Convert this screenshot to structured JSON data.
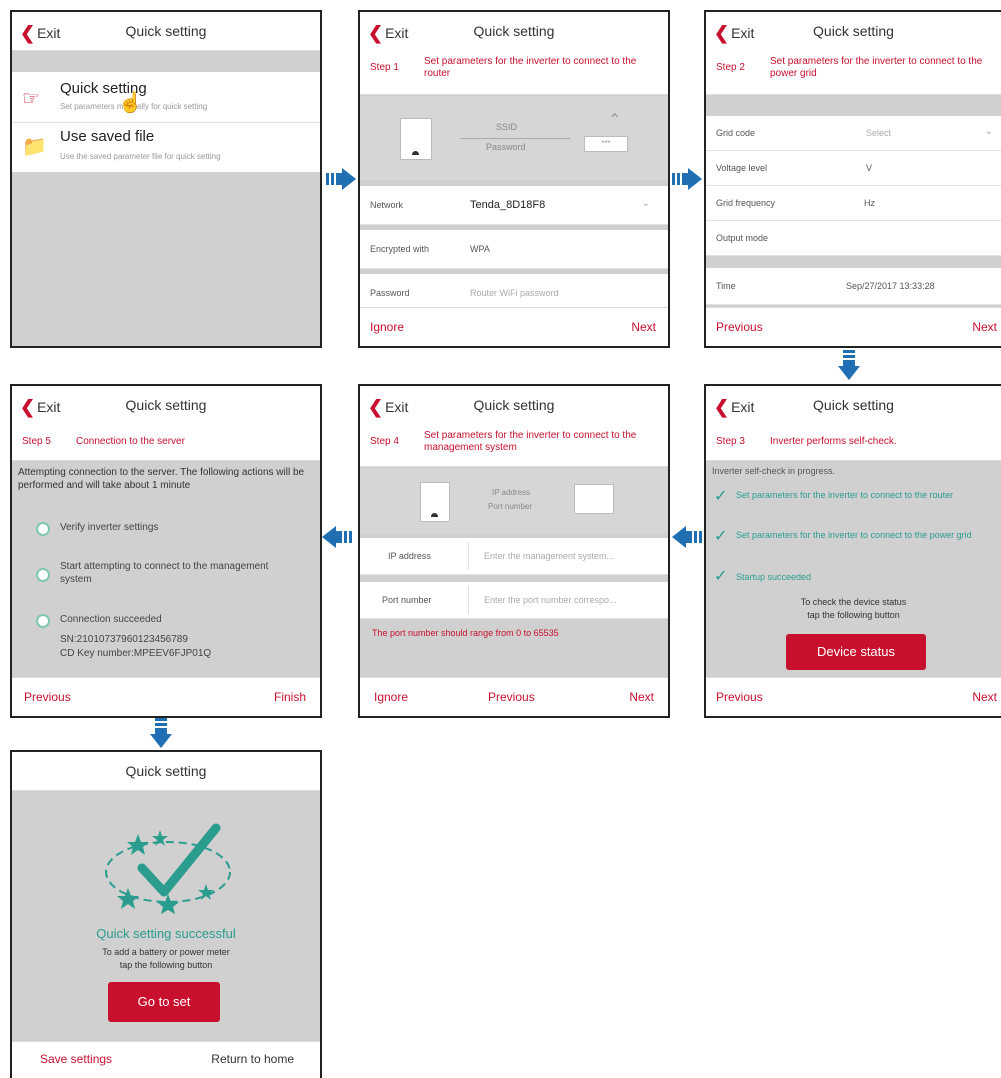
{
  "common": {
    "exit": "Exit",
    "title": "Quick setting",
    "ignore": "Ignore",
    "next": "Next",
    "previous": "Previous",
    "finish": "Finish"
  },
  "screen1": {
    "item1_title": "Quick setting",
    "item1_desc": "Set parameters manually for quick setting",
    "item2_title": "Use saved file",
    "item2_desc": "Use the saved parameter file for quick setting"
  },
  "screen2": {
    "step": "Step 1",
    "desc": "Set parameters for the inverter to connect to the router",
    "ssid": "SSID",
    "password_label": "Password",
    "pwd_mask": "***",
    "network_label": "Network",
    "network_value": "Tenda_8D18F8",
    "encrypted_label": "Encrypted with",
    "encrypted_value": "WPA",
    "password_row_label": "Password",
    "password_placeholder": "Router WiFi password"
  },
  "screen3": {
    "step": "Step 2",
    "desc": "Set parameters for the inverter to connect to the power grid",
    "grid_code_label": "Grid code",
    "grid_code_value": "Select",
    "voltage_label": "Voltage level",
    "voltage_unit": "V",
    "freq_label": "Grid frequency",
    "freq_unit": "Hz",
    "output_label": "Output mode",
    "time_label": "Time",
    "time_value": "Sep/27/2017 13:33:28"
  },
  "screen4": {
    "step": "Step 5",
    "desc": "Connection to the server",
    "intro": "Attempting connection to the server. The following actions will be performed and will take about 1 minute",
    "item1": "Verify inverter settings",
    "item2": "Start attempting to connect to the management system",
    "item3": "Connection succeeded",
    "sn": "SN:2101073796012345678​9",
    "cdkey": "CD Key number:MPEEV6FJP01Q"
  },
  "screen5": {
    "step": "Step 4",
    "desc": "Set parameters for the inverter to connect to the management system",
    "ip_caption": "IP address",
    "port_caption": "Port number",
    "ip_label": "IP address",
    "ip_placeholder": "Enter the management system...",
    "port_label": "Port number",
    "port_placeholder": "Enter the port number correspo...",
    "error": "The port number should range from 0 to 65535"
  },
  "screen6": {
    "step": "Step 3",
    "desc": "Inverter performs self-check.",
    "intro": "Inverter self-check in progress.",
    "check1": "Set parameters for the inverter to connect to the router",
    "check2": "Set parameters for the inverter to connect to the power grid",
    "check3": "Startup succeeded",
    "hint1": "To check the device status",
    "hint2": "tap the following button",
    "button": "Device status"
  },
  "screen7": {
    "title": "Quick setting",
    "success": "Quick setting successful",
    "hint1": "To add a battery or power meter",
    "hint2": "tap the following button",
    "button": "Go to set",
    "save": "Save settings",
    "home": "Return to home"
  },
  "colors": {
    "accent": "#c8102e",
    "teal": "#2a9d8f",
    "arrow": "#1f6fb2",
    "panel": "#d0d0d0"
  }
}
